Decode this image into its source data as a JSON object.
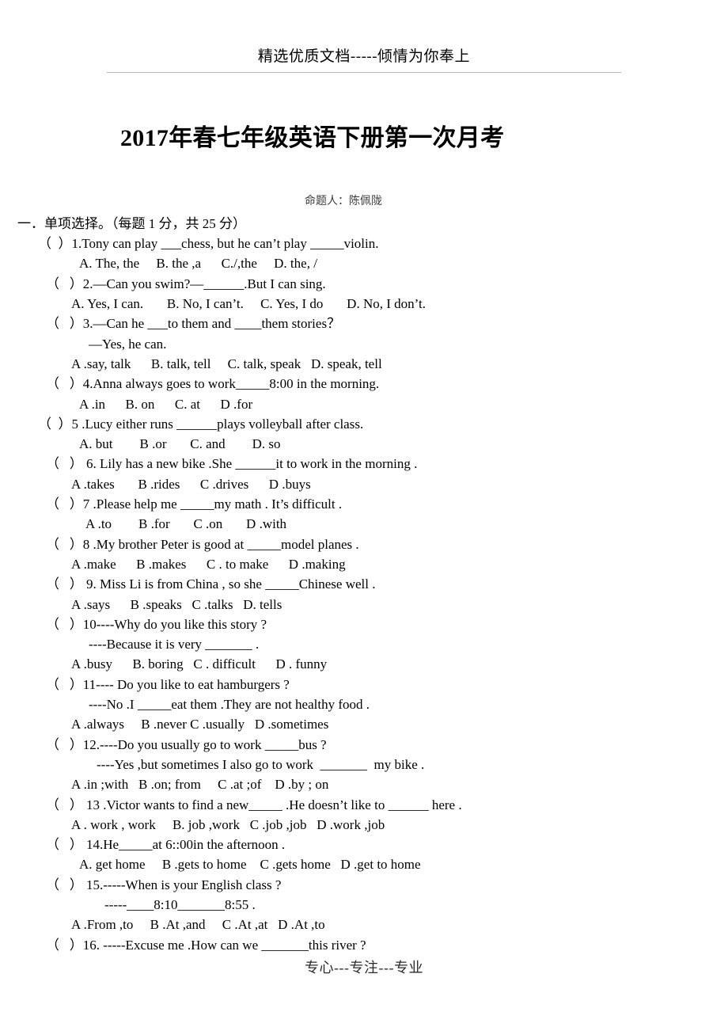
{
  "header": {
    "running_head": "精选优质文档-----倾情为你奉上"
  },
  "title": {
    "main": "2017年春七年级英语下册第一次月考",
    "author": "命题人：陈佩陇"
  },
  "section": {
    "heading": "一．单项选择。（每题 1 分，共 25 分）"
  },
  "questions": [
    {
      "marker": "（  ）",
      "number": "1.",
      "stem": "Tony can play ___chess, but he can’t play _____violin.",
      "options": "A. The, the     B. the ,a      C./,the     D. the, /"
    },
    {
      "marker": "（   ）",
      "number": "2.",
      "stem": "—Can you swim?—______.But I can sing.",
      "options": "A. Yes, I can.       B. No, I can’t.     C. Yes, I do       D. No, I don’t."
    },
    {
      "marker": "（   ）",
      "number": "3.",
      "stem": "—Can he ___to them and ____them stories？",
      "continuation": "—Yes, he can.",
      "options": "A .say, talk      B. talk, tell     C. talk, speak   D. speak, tell"
    },
    {
      "marker": "（   ）",
      "number": "4.",
      "stem": "Anna always goes to work_____8:00 in the morning.",
      "options": "A .in      B. on      C. at      D .for"
    },
    {
      "marker": "（  ）",
      "number": "5 .",
      "stem": "Lucy either runs ______plays volleyball after class.",
      "options": "A. but        B .or       C. and        D. so"
    },
    {
      "marker": "（   ）",
      "number": " 6. ",
      "stem": "Lily has a new bike .She ______it to work in the morning .",
      "options": "A .takes       B .rides      C .drives      D .buys"
    },
    {
      "marker": "（   ）",
      "number": "7 .",
      "stem": "Please help me _____my math . It’s difficult .",
      "options": "A .to        B .for       C .on       D .with"
    },
    {
      "marker": "（   ）",
      "number": "8 .",
      "stem": "My brother Peter is good at _____model planes .",
      "options": "A .make      B .makes      C . to make      D .making"
    },
    {
      "marker": "（   ）",
      "number": " 9. ",
      "stem": "Miss Li is from China , so she _____Chinese well .",
      "options": "A .says      B .speaks   C .talks   D. tells"
    },
    {
      "marker": "（   ）",
      "number": "10",
      "stem": "----Why do you like this story ?",
      "continuation": "----Because it is very _______ .",
      "options": "A .busy      B. boring   C . difficult      D . funny"
    },
    {
      "marker": "（   ）",
      "number": "11",
      "stem": "---- Do you like to eat hamburgers ?",
      "continuation": "----No .I _____eat them .They are not healthy food .",
      "options": "A .always     B .never C .usually   D .sometimes"
    },
    {
      "marker": "（   ）",
      "number": "12.",
      "stem": "----Do you usually go to work _____bus ?",
      "continuation": "----Yes ,but sometimes I also go to work  _______  my bike .",
      "options": "A .in ;with   B .on; from     C .at ;of    D .by ; on"
    },
    {
      "marker": "（   ）",
      "number": " 13 .",
      "stem": "Victor wants to find a new_____ .He doesn’t like to ______ here .",
      "options": "A . work , work     B. job ,work   C .job ,job   D .work ,job"
    },
    {
      "marker": "（   ）",
      "number": " 14.",
      "stem": "He_____at 6::00in the afternoon .",
      "options": "A. get home     B .gets to home    C .gets home   D .get to home"
    },
    {
      "marker": "（   ）",
      "number": " 15.",
      "stem": "-----When is your English class ?",
      "continuation": "-----____8:10_______8:55 .",
      "options": "A .From ,to     B .At ,and     C .At ,at   D .At ,to"
    },
    {
      "marker": "（   ）",
      "number": "16. ",
      "stem": "-----Excuse me .How can we _______this river ?",
      "options": ""
    }
  ],
  "footer": {
    "text": "专心---专注---专业"
  }
}
